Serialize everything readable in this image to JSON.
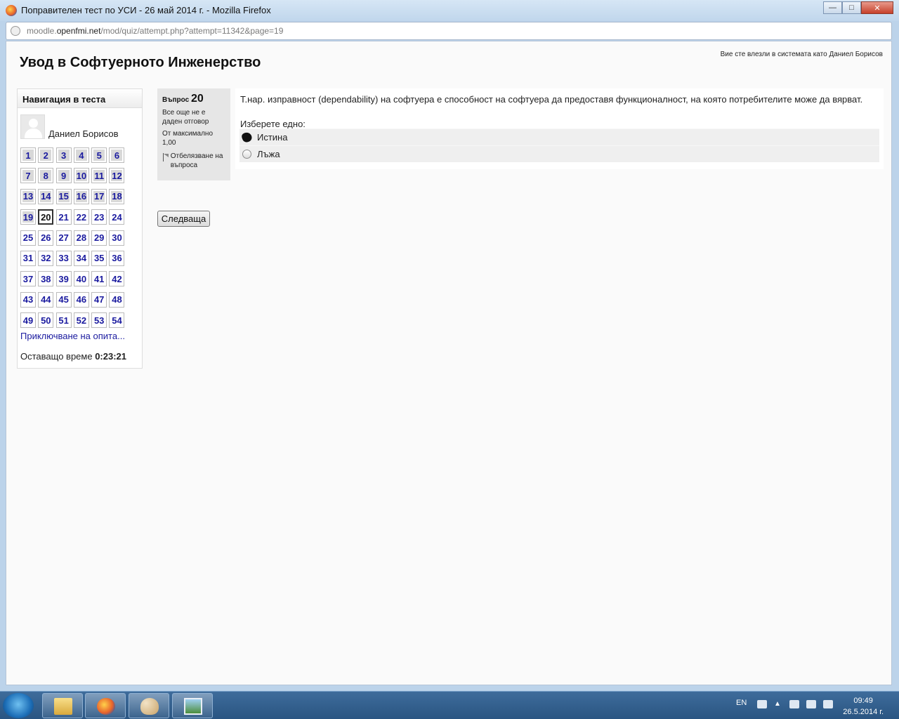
{
  "window": {
    "title": "Поправителен тест по УСИ - 26 май 2014 г. - Mozilla Firefox",
    "buttons": {
      "minimize": "—",
      "maximize": "□",
      "close": "✕"
    }
  },
  "urlbar": {
    "domain_prefix": "moodle.",
    "domain": "openfmi.net",
    "path": "/mod/quiz/attempt.php?attempt=11342&page=19"
  },
  "page": {
    "course_title": "Увод в Софтуерното Инженерство",
    "login_info": "Вие сте влезли в системата като Даниел Борисов"
  },
  "nav": {
    "header": "Навигация в теста",
    "user_name": "Даниел Борисов",
    "questions": [
      {
        "n": "1",
        "state": "answered"
      },
      {
        "n": "2",
        "state": "answered"
      },
      {
        "n": "3",
        "state": "answered"
      },
      {
        "n": "4",
        "state": "answered"
      },
      {
        "n": "5",
        "state": "answered"
      },
      {
        "n": "6",
        "state": "answered"
      },
      {
        "n": "7",
        "state": "answered"
      },
      {
        "n": "8",
        "state": "answered"
      },
      {
        "n": "9",
        "state": "answered"
      },
      {
        "n": "10",
        "state": "answered"
      },
      {
        "n": "11",
        "state": "answered"
      },
      {
        "n": "12",
        "state": "answered"
      },
      {
        "n": "13",
        "state": "answered"
      },
      {
        "n": "14",
        "state": "answered"
      },
      {
        "n": "15",
        "state": "answered"
      },
      {
        "n": "16",
        "state": "answered"
      },
      {
        "n": "17",
        "state": "answered"
      },
      {
        "n": "18",
        "state": "answered"
      },
      {
        "n": "19",
        "state": "answered"
      },
      {
        "n": "20",
        "state": "current"
      },
      {
        "n": "21",
        "state": "open"
      },
      {
        "n": "22",
        "state": "open"
      },
      {
        "n": "23",
        "state": "open"
      },
      {
        "n": "24",
        "state": "open"
      },
      {
        "n": "25",
        "state": "open"
      },
      {
        "n": "26",
        "state": "open"
      },
      {
        "n": "27",
        "state": "open"
      },
      {
        "n": "28",
        "state": "open"
      },
      {
        "n": "29",
        "state": "open"
      },
      {
        "n": "30",
        "state": "open"
      },
      {
        "n": "31",
        "state": "open"
      },
      {
        "n": "32",
        "state": "open"
      },
      {
        "n": "33",
        "state": "open"
      },
      {
        "n": "34",
        "state": "open"
      },
      {
        "n": "35",
        "state": "open"
      },
      {
        "n": "36",
        "state": "open"
      },
      {
        "n": "37",
        "state": "open"
      },
      {
        "n": "38",
        "state": "open"
      },
      {
        "n": "39",
        "state": "open"
      },
      {
        "n": "40",
        "state": "open"
      },
      {
        "n": "41",
        "state": "open"
      },
      {
        "n": "42",
        "state": "open"
      },
      {
        "n": "43",
        "state": "open"
      },
      {
        "n": "44",
        "state": "open"
      },
      {
        "n": "45",
        "state": "open"
      },
      {
        "n": "46",
        "state": "open"
      },
      {
        "n": "47",
        "state": "open"
      },
      {
        "n": "48",
        "state": "open"
      },
      {
        "n": "49",
        "state": "open"
      },
      {
        "n": "50",
        "state": "open"
      },
      {
        "n": "51",
        "state": "open"
      },
      {
        "n": "52",
        "state": "open"
      },
      {
        "n": "53",
        "state": "open"
      },
      {
        "n": "54",
        "state": "open"
      }
    ],
    "finish_link": "Приключване на опита...",
    "time_label": "Оставащо време",
    "time_value": "0:23:21"
  },
  "question": {
    "label": "Въпрос",
    "number": "20",
    "status": "Все още не е даден отговор",
    "max_label": "От максимално",
    "max_value": "1,00",
    "flag_label": "Отбелязване на въпроса",
    "text": "Т.нар. изправност (dependability) на софтуера е способност на софтуера да предоставя функционалност, на която потребителите може да вярват.",
    "prompt": "Изберете едно:",
    "options": [
      {
        "label": "Истина",
        "checked": true
      },
      {
        "label": "Лъжа",
        "checked": false
      }
    ],
    "next_button": "Следваща"
  },
  "taskbar": {
    "apps": [
      "folder-icon",
      "firefox-icon",
      "paint-icon",
      "photo-viewer-icon"
    ],
    "lang": "EN",
    "time": "09:49",
    "date": "26.5.2014 г."
  }
}
